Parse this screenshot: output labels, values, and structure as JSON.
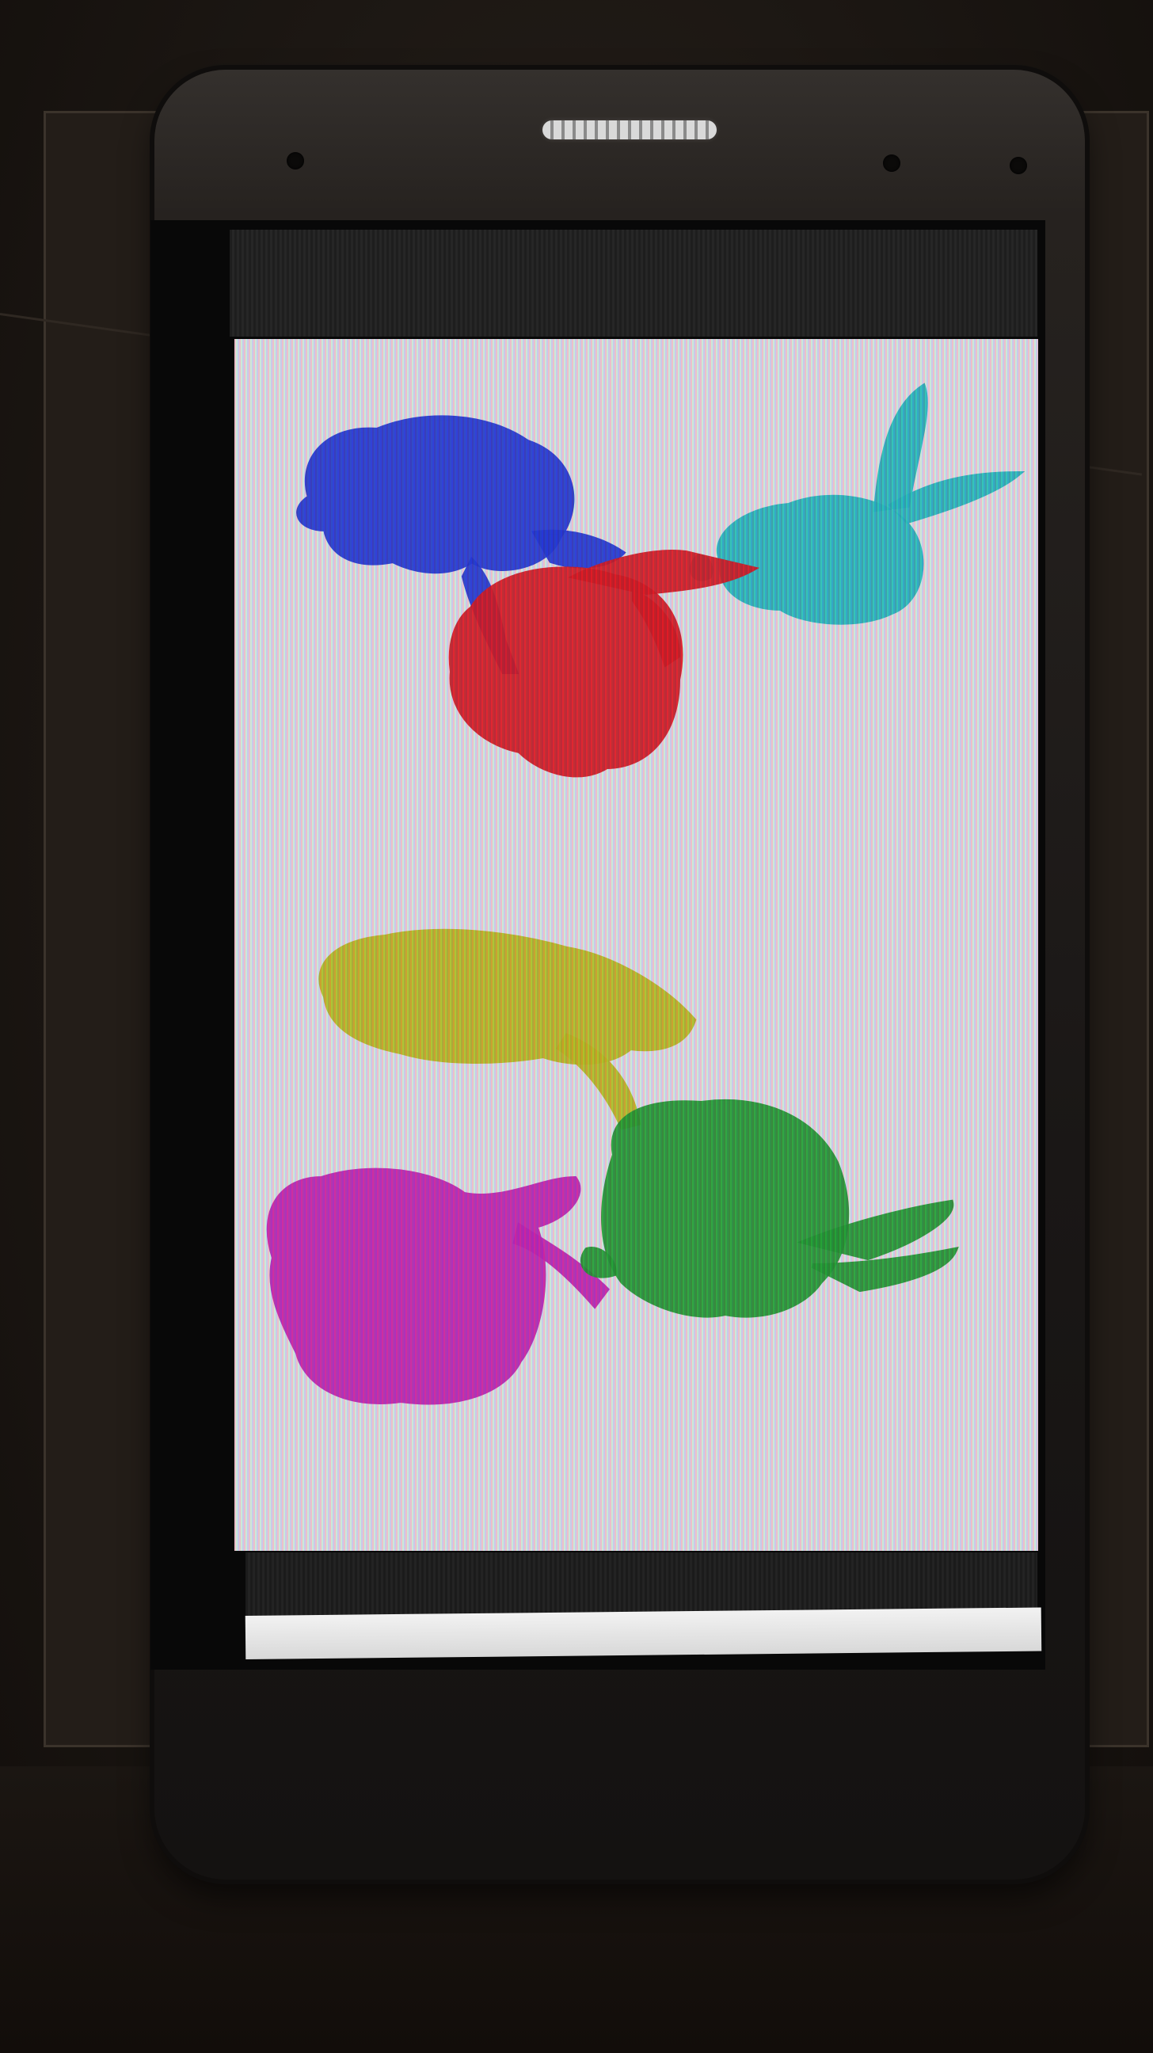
{
  "scene": {
    "device": "smartphone",
    "bunnies": [
      {
        "color": "#2a3ed8"
      },
      {
        "color": "#2fc1c4"
      },
      {
        "color": "#e0202a"
      },
      {
        "color": "#c8c22a"
      },
      {
        "color": "#cc2ab8"
      },
      {
        "color": "#2aa23a"
      }
    ],
    "screen_background": "#ece9ea",
    "body_color": "#26221f"
  }
}
